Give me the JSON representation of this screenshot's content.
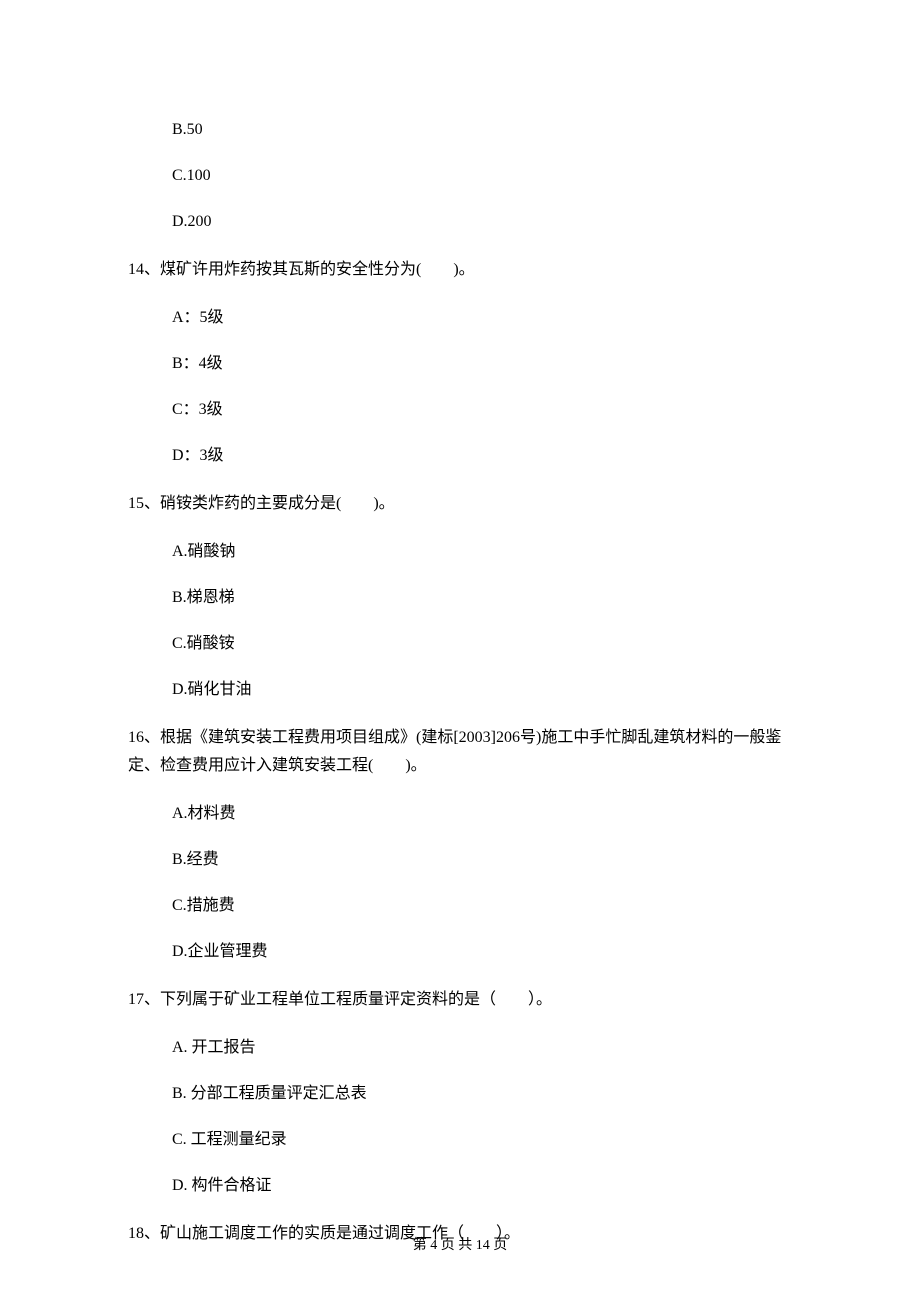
{
  "q13_options": {
    "b": "B.50",
    "c": "C.100",
    "d": "D.200"
  },
  "q14": {
    "text": "14、煤矿许用炸药按其瓦斯的安全性分为(　　)。",
    "options": {
      "a": "A：5级",
      "b": "B：4级",
      "c": "C：3级",
      "d": "D：3级"
    }
  },
  "q15": {
    "text": "15、硝铵类炸药的主要成分是(　　)。",
    "options": {
      "a": "A.硝酸钠",
      "b": "B.梯恩梯",
      "c": "C.硝酸铵",
      "d": "D.硝化甘油"
    }
  },
  "q16": {
    "text": "16、根据《建筑安装工程费用项目组成》(建标[2003]206号)施工中手忙脚乱建筑材料的一般鉴定、检查费用应计入建筑安装工程(　　)。",
    "options": {
      "a": "A.材料费",
      "b": "B.经费",
      "c": "C.措施费",
      "d": "D.企业管理费"
    }
  },
  "q17": {
    "text": "17、下列属于矿业工程单位工程质量评定资料的是（　　）。",
    "options": {
      "a": "A. 开工报告",
      "b": "B. 分部工程质量评定汇总表",
      "c": "C. 工程测量纪录",
      "d": "D. 构件合格证"
    }
  },
  "q18": {
    "text": "18、矿山施工调度工作的实质是通过调度工作（　　）。"
  },
  "footer": "第 4 页 共 14 页"
}
